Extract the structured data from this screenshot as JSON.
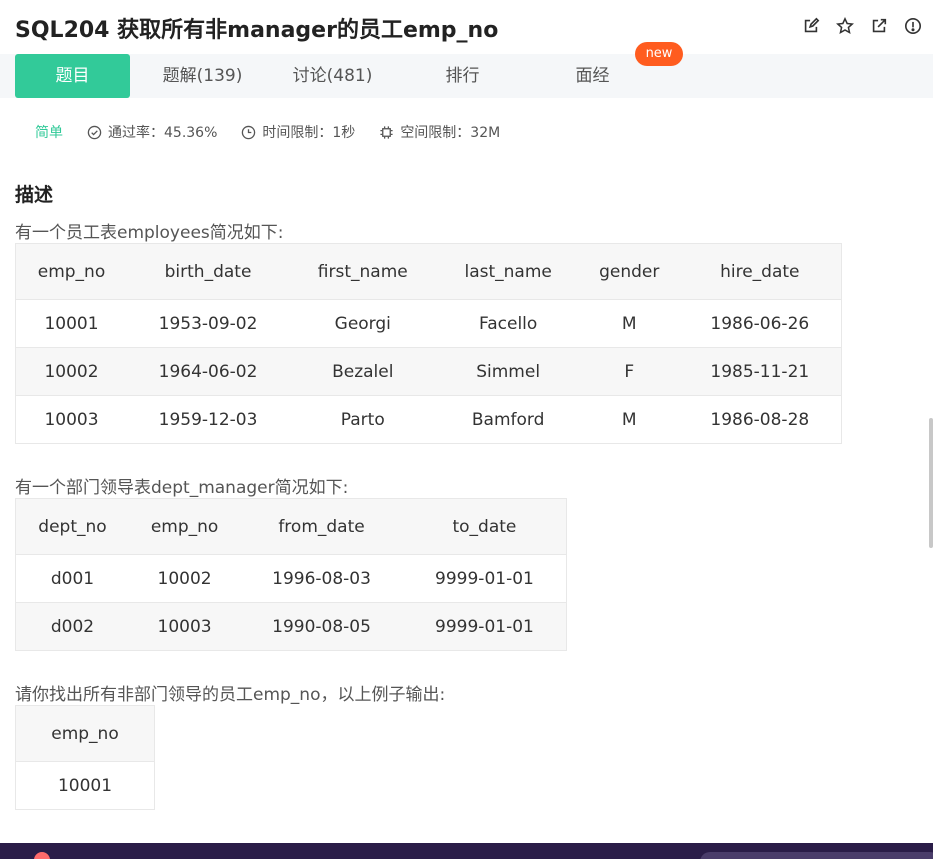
{
  "header": {
    "title": "SQL204  获取所有非manager的员工emp_no",
    "icons": [
      "edit-icon",
      "star-icon",
      "external-link-icon",
      "info-icon"
    ]
  },
  "tabs": [
    {
      "label": "题目",
      "active": true
    },
    {
      "label": "题解(139)",
      "active": false
    },
    {
      "label": "讨论(481)",
      "active": false
    },
    {
      "label": "排行",
      "active": false
    },
    {
      "label": "面经",
      "active": false
    }
  ],
  "new_badge": "new",
  "meta": {
    "difficulty": "简单",
    "pass_rate": "通过率：45.36%",
    "time_limit": "时间限制：1秒",
    "space_limit": "空间限制：32M"
  },
  "description": {
    "title": "描述",
    "p1": "有一个员工表employees简况如下:",
    "p2": "有一个部门领导表dept_manager简况如下:",
    "p3": "请你找出所有非部门领导的员工emp_no，以上例子输出:"
  },
  "employees": {
    "headers": [
      "emp_no",
      "birth_date",
      "first_name",
      "last_name",
      "gender",
      "hire_date"
    ],
    "rows": [
      [
        "10001",
        "1953-09-02",
        "Georgi",
        "Facello",
        "M",
        "1986-06-26"
      ],
      [
        "10002",
        "1964-06-02",
        "Bezalel",
        "Simmel",
        "F",
        "1985-11-21"
      ],
      [
        "10003",
        "1959-12-03",
        "Parto",
        "Bamford",
        "M",
        "1986-08-28"
      ]
    ]
  },
  "dept_manager": {
    "headers": [
      "dept_no",
      "emp_no",
      "from_date",
      "to_date"
    ],
    "rows": [
      [
        "d001",
        "10002",
        "1996-08-03",
        "9999-01-01"
      ],
      [
        "d002",
        "10003",
        "1990-08-05",
        "9999-01-01"
      ]
    ]
  },
  "output": {
    "headers": [
      "emp_no"
    ],
    "rows": [
      [
        "10001"
      ]
    ]
  },
  "colors": {
    "accent": "#32ca99",
    "badge": "#ff5c1f"
  }
}
